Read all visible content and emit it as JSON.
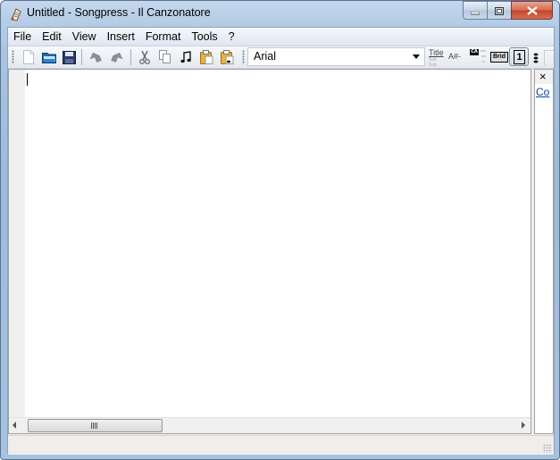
{
  "window": {
    "title": "Untitled - Songpress - Il Canzonatore",
    "icon": "songpress-app-icon",
    "controls": {
      "minimize": "minimize-icon",
      "maximize": "maximize-icon",
      "close": "close-icon"
    }
  },
  "menubar": {
    "items": [
      {
        "label": "File"
      },
      {
        "label": "Edit"
      },
      {
        "label": "View"
      },
      {
        "label": "Insert"
      },
      {
        "label": "Format"
      },
      {
        "label": "Tools"
      },
      {
        "label": "?"
      }
    ]
  },
  "toolbar": {
    "buttons": [
      {
        "name": "new",
        "icon": "new-file-icon"
      },
      {
        "name": "open",
        "icon": "open-folder-icon"
      },
      {
        "name": "save",
        "icon": "save-icon"
      },
      {
        "name": "undo",
        "icon": "undo-icon"
      },
      {
        "name": "redo",
        "icon": "redo-icon"
      },
      {
        "name": "cut",
        "icon": "cut-icon"
      },
      {
        "name": "copy",
        "icon": "copy-icon"
      },
      {
        "name": "copy-as-image",
        "icon": "music-note-icon"
      },
      {
        "name": "paste",
        "icon": "paste-icon"
      },
      {
        "name": "paste-chords",
        "icon": "paste-chords-icon"
      }
    ],
    "font": {
      "selected": "Arial"
    },
    "format_buttons": {
      "title_label": "Title",
      "title_sub": "Sub Sub",
      "chord_label": "A#-",
      "ca_label": "CA",
      "brid_label": "Brid",
      "verse_number_label": "1"
    }
  },
  "editor": {
    "content": ""
  },
  "side_panel": {
    "close_label": "×",
    "link_label": "Co"
  },
  "statusbar": {
    "text": ""
  }
}
